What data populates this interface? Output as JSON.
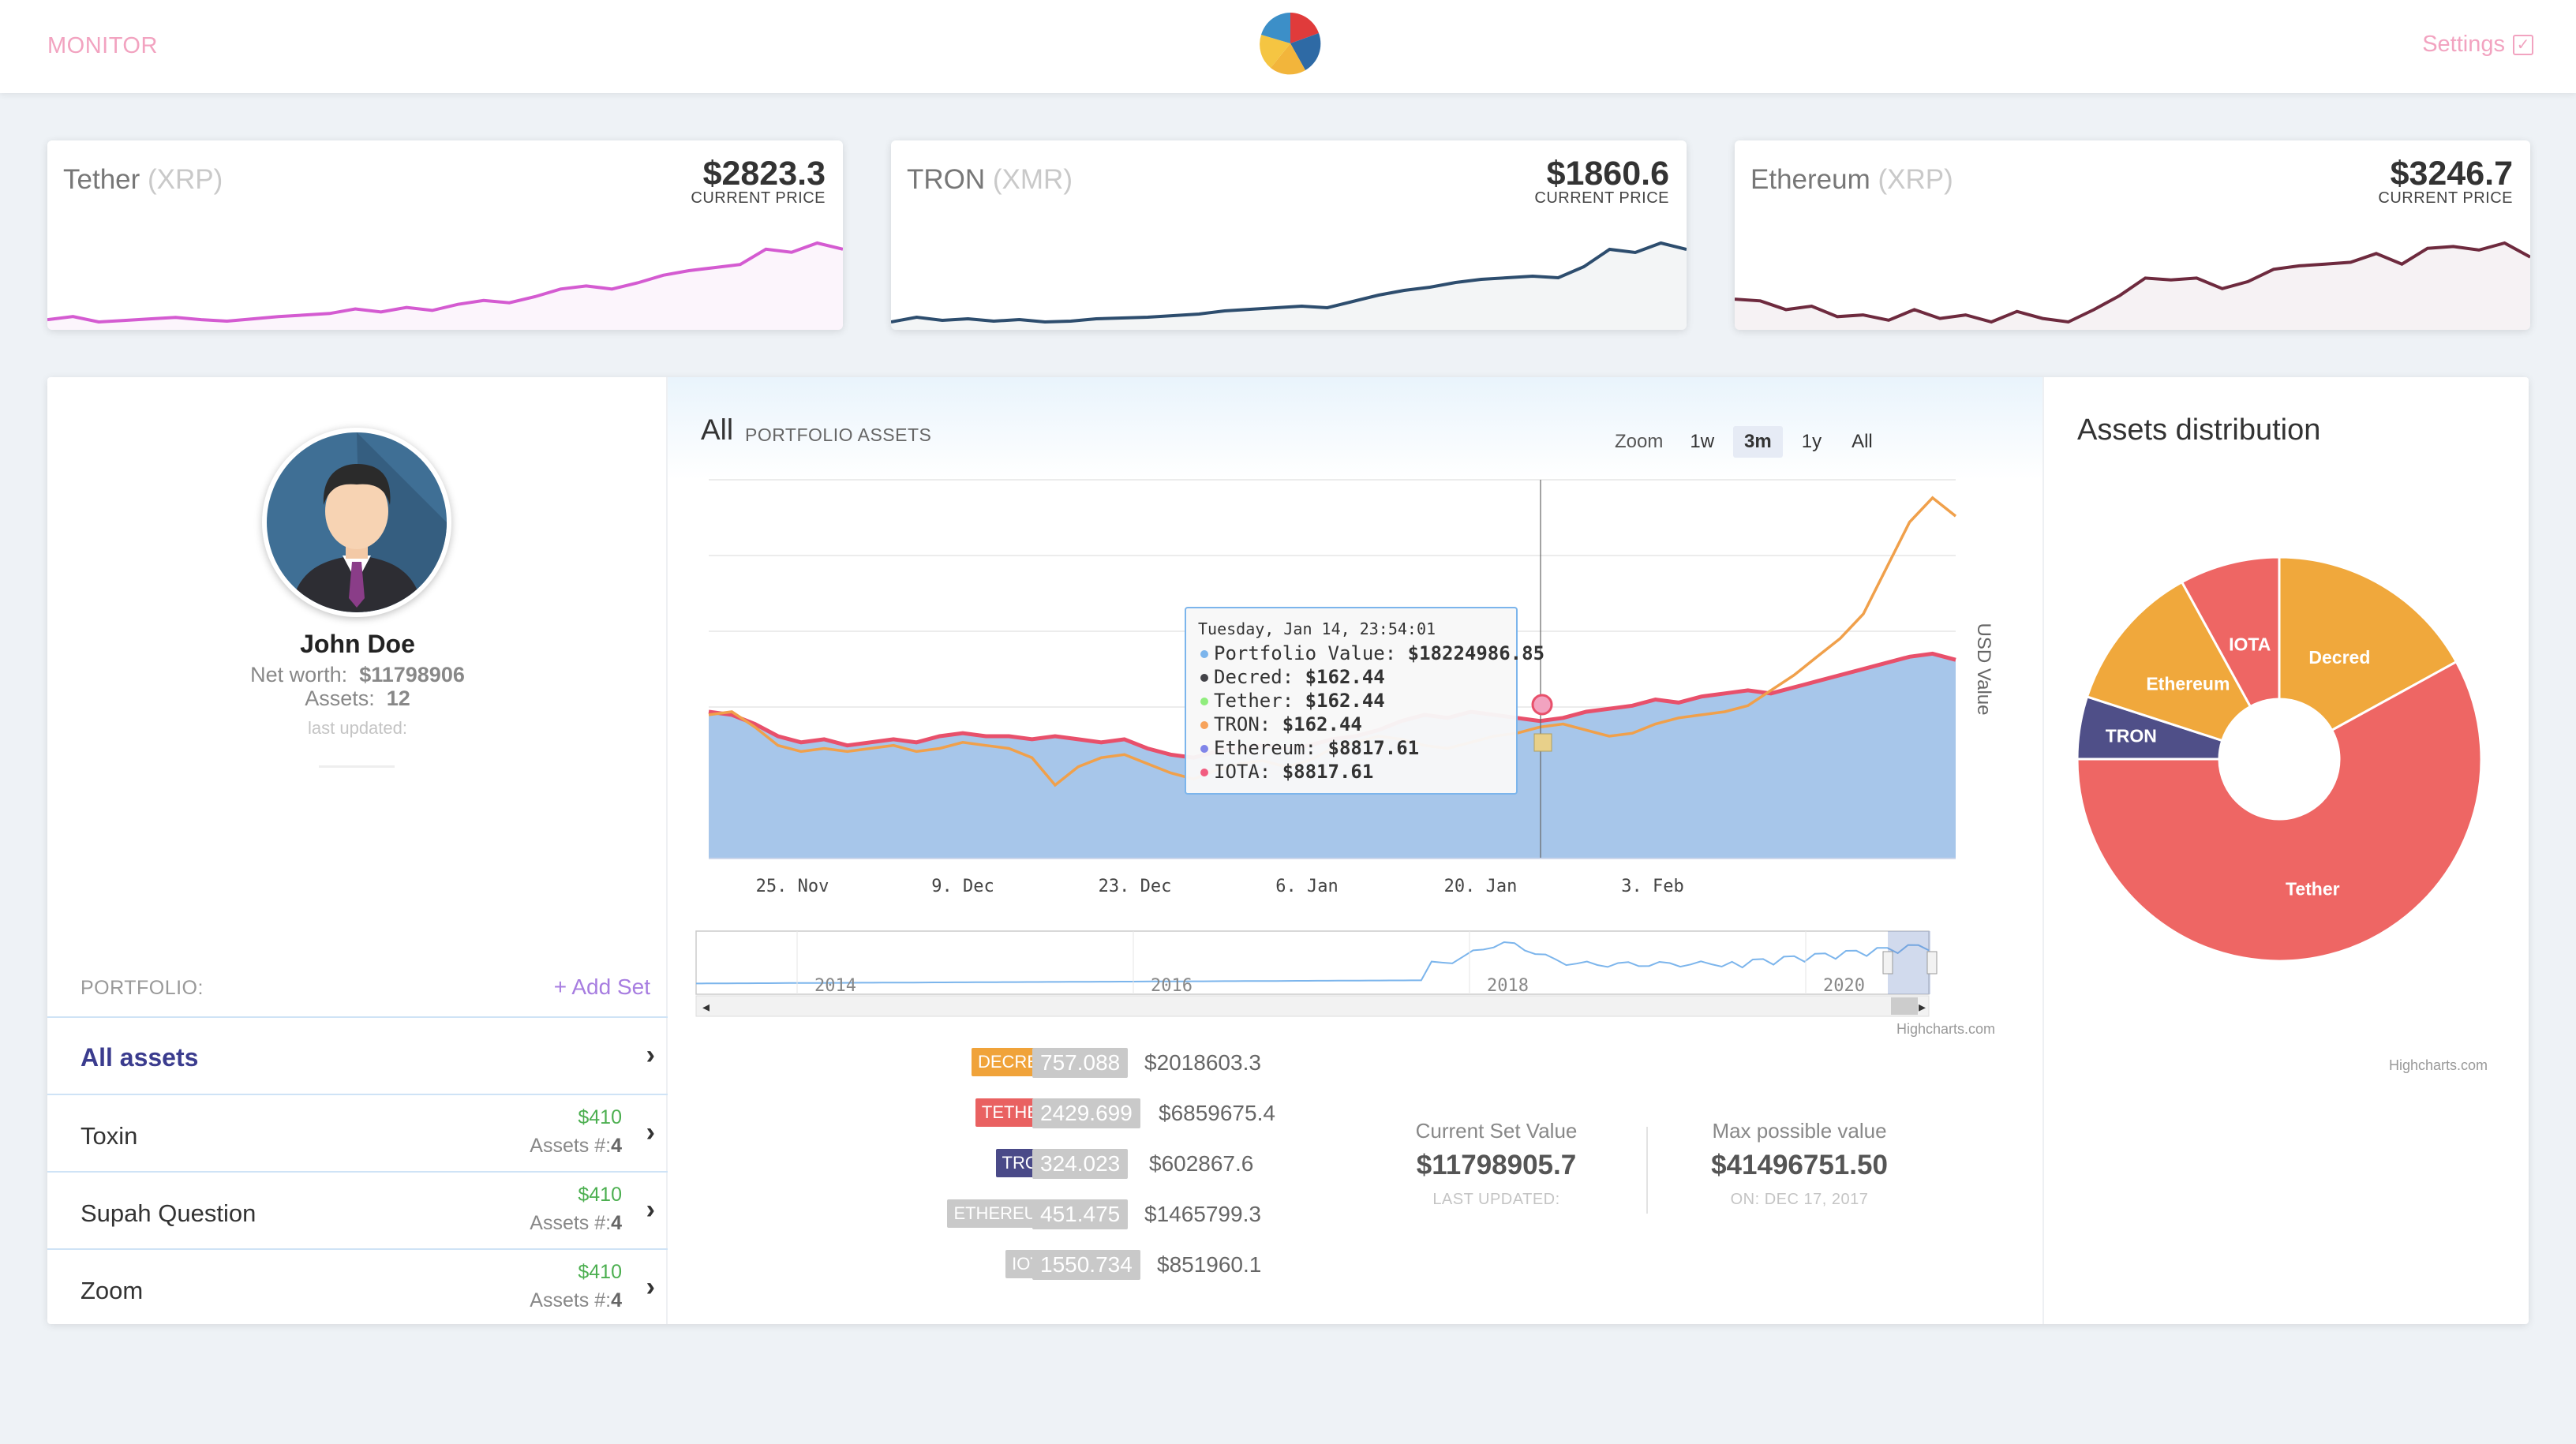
{
  "header": {
    "brand": "MONITOR",
    "settings_label": "Settings",
    "settings_icon": "checkbox-icon",
    "logo_icon": "pie-logo-icon"
  },
  "tickers": [
    {
      "name": "Tether",
      "symbol": "(XRP)",
      "price": "$2823.3",
      "price_label": "CURRENT PRICE",
      "color": "#d45bd1",
      "spark": [
        8,
        12,
        5,
        7,
        9,
        11,
        8,
        6,
        9,
        12,
        14,
        16,
        22,
        18,
        24,
        20,
        28,
        33,
        30,
        38,
        48,
        52,
        48,
        56,
        66,
        72,
        76,
        80,
        100,
        96,
        108,
        100
      ]
    },
    {
      "name": "TRON",
      "symbol": "(XMR)",
      "price": "$1860.6",
      "price_label": "CURRENT PRICE",
      "color": "#2d4d6e",
      "spark": [
        4,
        10,
        6,
        8,
        5,
        7,
        4,
        5,
        8,
        9,
        10,
        12,
        14,
        18,
        20,
        22,
        24,
        22,
        30,
        38,
        44,
        48,
        54,
        58,
        60,
        62,
        60,
        74,
        96,
        92,
        104,
        96
      ]
    },
    {
      "name": "Ethereum",
      "symbol": "(XRP)",
      "price": "$3246.7",
      "price_label": "CURRENT PRICE",
      "color": "#6e2a3e",
      "spark": [
        32,
        30,
        20,
        24,
        12,
        14,
        8,
        20,
        10,
        14,
        6,
        18,
        10,
        6,
        20,
        36,
        56,
        54,
        56,
        44,
        52,
        66,
        70,
        72,
        74,
        84,
        72,
        90,
        92,
        88,
        96,
        80
      ]
    }
  ],
  "profile": {
    "name": "John Doe",
    "net_worth_label": "Net worth:",
    "net_worth": "$11798906",
    "assets_label": "Assets:",
    "assets": "12",
    "last_updated": "last updated:",
    "avatar_icon": "user-avatar-icon"
  },
  "portfolio": {
    "label": "PORTFOLIO:",
    "add_set": "+ Add Set",
    "items": [
      {
        "label": "All assets",
        "value": "",
        "count_label": "",
        "count": ""
      },
      {
        "label": "Toxin",
        "value": "$410",
        "count_label": "Assets #:",
        "count": "4"
      },
      {
        "label": "Supah Question",
        "value": "$410",
        "count_label": "Assets #:",
        "count": "4"
      },
      {
        "label": "Zoom",
        "value": "$410",
        "count_label": "Assets #:",
        "count": "4"
      }
    ]
  },
  "chart": {
    "title": "All",
    "subtitle": "PORTFOLIO ASSETS",
    "zoom_label": "Zoom",
    "zoom_buttons": [
      "1w",
      "3m",
      "1y",
      "All"
    ],
    "zoom_active": "3m",
    "credit": "Highcharts.com"
  },
  "chart_data": {
    "type": "area",
    "ylabel": "USD Value",
    "x_ticks": [
      "25. Nov",
      "9. Dec",
      "23. Dec",
      "6. Jan",
      "20. Jan",
      "3. Feb"
    ],
    "navigator_ticks": [
      "2014",
      "2016",
      "2018",
      "2020"
    ],
    "series": [
      {
        "name": "Portfolio Value",
        "color": "#a7c6ea",
        "values": [
          48,
          47,
          44,
          40,
          38,
          39,
          37,
          38,
          39,
          38,
          40,
          41,
          40,
          40,
          39,
          40,
          39,
          38,
          39,
          36,
          34,
          33,
          35,
          36,
          37,
          36,
          37,
          39,
          40,
          42,
          45,
          47,
          46,
          48,
          47,
          46,
          45,
          46,
          48,
          49,
          50,
          52,
          51,
          53,
          54,
          55,
          54,
          56,
          58,
          60,
          62,
          64,
          66,
          67,
          65
        ]
      },
      {
        "name": "IOTA",
        "color": "#e8506b",
        "values": [
          48,
          47,
          44,
          40,
          38,
          39,
          37,
          38,
          39,
          38,
          40,
          41,
          40,
          40,
          39,
          40,
          39,
          38,
          39,
          36,
          34,
          33,
          35,
          36,
          37,
          36,
          37,
          39,
          40,
          42,
          45,
          47,
          46,
          48,
          47,
          46,
          45,
          46,
          48,
          49,
          50,
          52,
          51,
          53,
          54,
          55,
          54,
          56,
          58,
          60,
          62,
          64,
          66,
          67,
          65
        ]
      },
      {
        "name": "TRON",
        "color": "#f0a04b",
        "values": [
          47,
          48,
          43,
          37,
          35,
          36,
          35,
          36,
          37,
          35,
          36,
          38,
          37,
          36,
          33,
          24,
          30,
          33,
          34,
          31,
          28,
          26,
          29,
          31,
          32,
          30,
          32,
          36,
          38,
          40,
          39,
          37,
          36,
          38,
          40,
          41,
          43,
          44,
          42,
          40,
          41,
          44,
          46,
          47,
          48,
          50,
          55,
          60,
          66,
          72,
          80,
          95,
          110,
          118,
          112
        ]
      }
    ],
    "tooltip": {
      "date": "Tuesday, Jan 14, 23:54:01",
      "rows": [
        {
          "label": "Portfolio Value:",
          "value": "$18224986.85",
          "color": "#7cb5ec"
        },
        {
          "label": "Decred:",
          "value": "$162.44",
          "color": "#434348"
        },
        {
          "label": "Tether:",
          "value": "$162.44",
          "color": "#90ed7d"
        },
        {
          "label": "TRON:",
          "value": "$162.44",
          "color": "#f7a35c"
        },
        {
          "label": "Ethereum:",
          "value": "$8817.61",
          "color": "#8085e9"
        },
        {
          "label": "IOTA:",
          "value": "$8817.61",
          "color": "#f15c80"
        }
      ]
    }
  },
  "holdings": [
    {
      "tag": "DECRED:",
      "color": "#f0a33a",
      "amount": "757.088",
      "value": "$2018603.3"
    },
    {
      "tag": "TETHER:",
      "color": "#e96161",
      "amount": "2429.699",
      "value": "$6859675.4"
    },
    {
      "tag": "TRON:",
      "color": "#4a4a88",
      "amount": "324.023",
      "value": "$602867.6"
    },
    {
      "tag": "ETHEREUM:",
      "color": "#c9c9c9",
      "amount": "451.475",
      "value": "$1465799.3"
    },
    {
      "tag": "IOTA:",
      "color": "#c9c9c9",
      "amount": "1550.734",
      "value": "$851960.1"
    }
  ],
  "set_values": {
    "current_title": "Current Set Value",
    "current_value": "$11798905.7",
    "current_sub": "LAST UPDATED:",
    "max_title": "Max possible value",
    "max_value": "$41496751.50",
    "max_sub": "ON: DEC 17, 2017"
  },
  "distribution": {
    "title": "Assets distribution",
    "credit": "Highcharts.com",
    "slices": [
      {
        "name": "Decred",
        "value": 17,
        "color": "#f0a83c"
      },
      {
        "name": "Tether",
        "value": 58,
        "color": "#ee6664"
      },
      {
        "name": "TRON",
        "value": 5,
        "color": "#4f4f88"
      },
      {
        "name": "Ethereum",
        "value": 12,
        "color": "#f0a83c"
      },
      {
        "name": "IOTA",
        "value": 8,
        "color": "#ee6664"
      }
    ]
  }
}
